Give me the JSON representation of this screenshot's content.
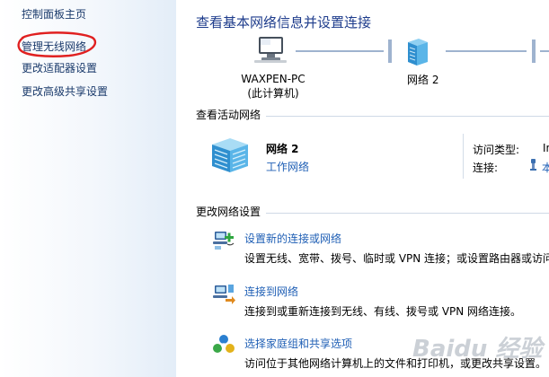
{
  "sidebar": {
    "home": "控制面板主页",
    "items": [
      {
        "label": "管理无线网络"
      },
      {
        "label": "更改适配器设置"
      },
      {
        "label": "更改高级共享设置"
      }
    ]
  },
  "main": {
    "title": "查看基本网络信息并设置连接",
    "network_map": {
      "computer_name": "WAXPEN-PC",
      "computer_caption": "(此计算机)",
      "network_name": "网络  2"
    },
    "active_section": {
      "label": "查看活动网络",
      "network_name": "网络  2",
      "network_type": "工作网络",
      "access_type_label": "访问类型:",
      "access_type_value": "In",
      "connection_label": "连接:",
      "connection_value": "本"
    },
    "change_section": {
      "label": "更改网络设置",
      "tasks": [
        {
          "link": "设置新的连接或网络",
          "desc": "设置无线、宽带、拨号、临时或 VPN 连接；或设置路由器或访问",
          "icon": "new-connection-icon"
        },
        {
          "link": "连接到网络",
          "desc": "连接到或重新连接到无线、有线、拨号或 VPN 网络连接。",
          "icon": "connect-network-icon"
        },
        {
          "link": "选择家庭组和共享选项",
          "desc": "访问位于其他网络计算机上的文件和打印机，或更改共享设置。",
          "icon": "homegroup-icon"
        }
      ]
    }
  },
  "watermark": "Baidu 经验",
  "colors": {
    "title": "#1e3c8c",
    "link": "#1f5fb5",
    "sidebar_link": "#1a3a6b",
    "highlight_ellipse": "#e02020"
  }
}
